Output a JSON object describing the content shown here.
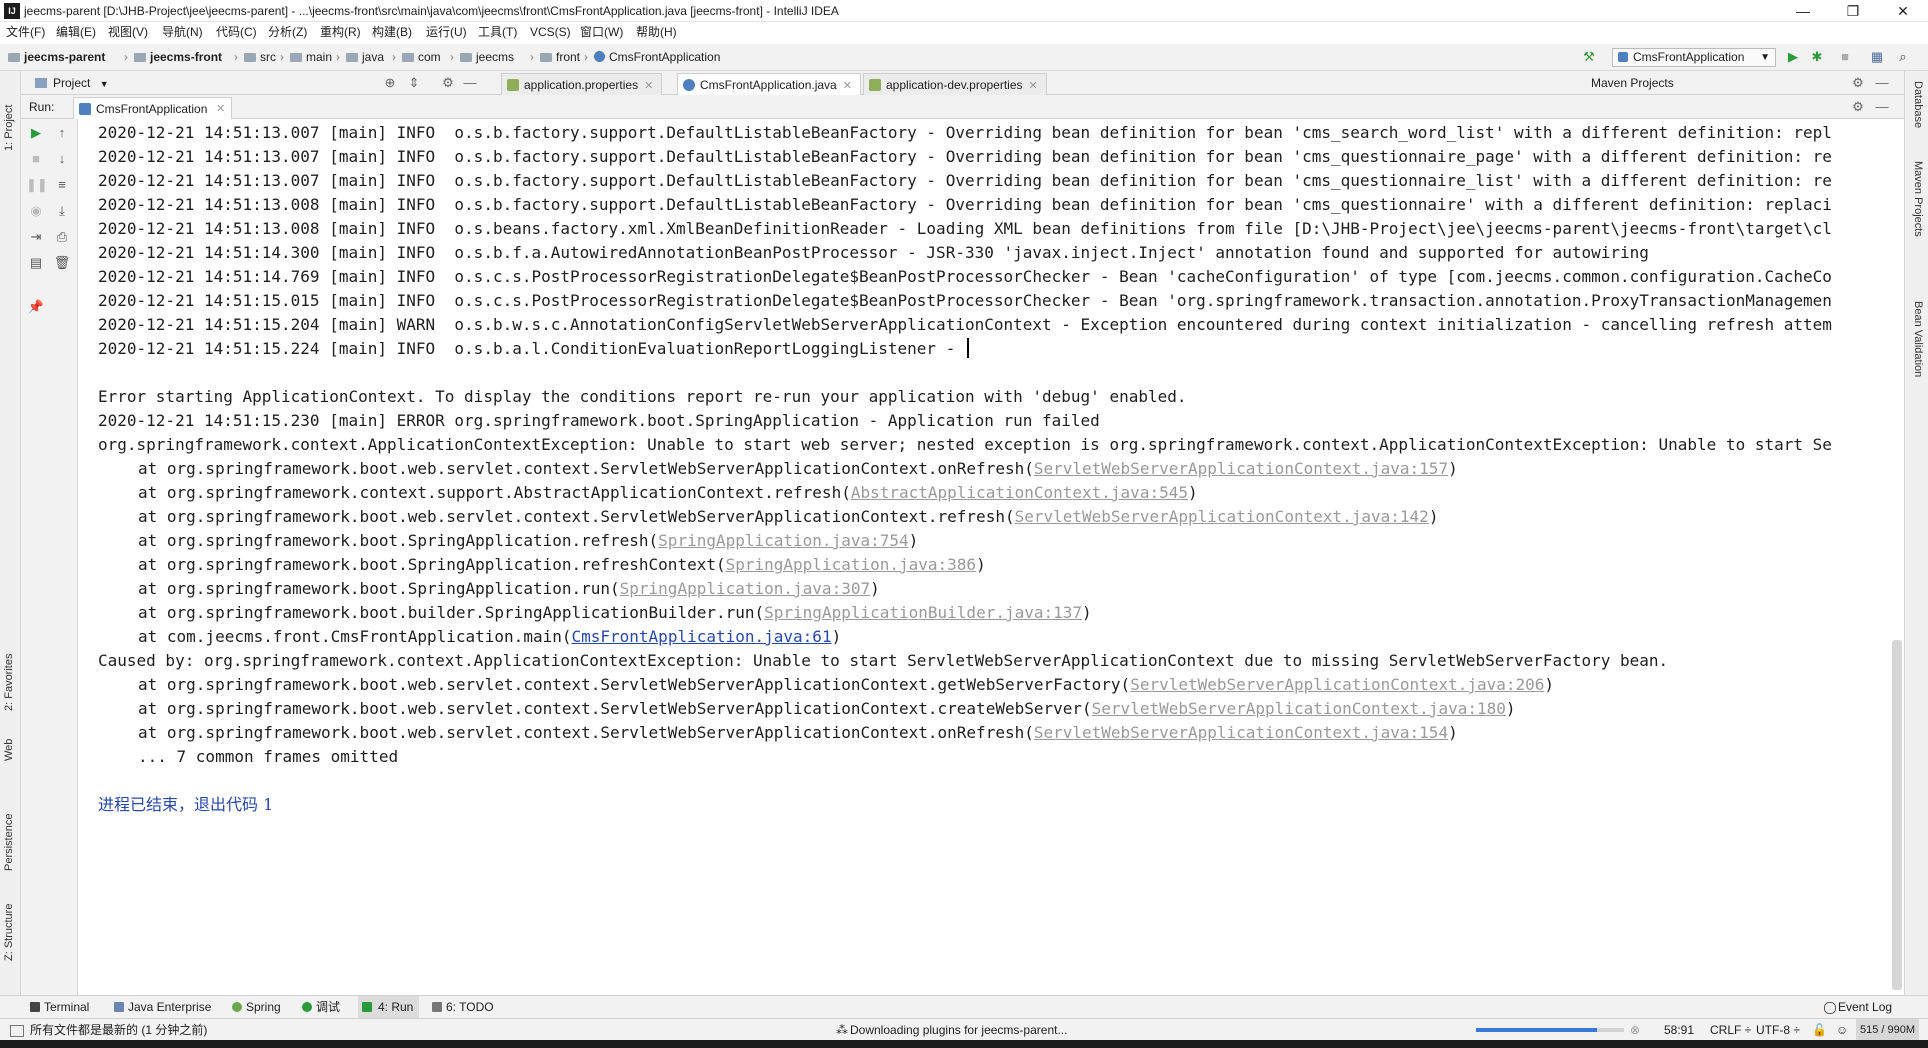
{
  "window": {
    "logo": "IJ",
    "title": "jeecms-parent [D:\\JHB-Project\\jee\\jeecms-parent] - ...\\jeecms-front\\src\\main\\java\\com\\jeecms\\front\\CmsFrontApplication.java [jeecms-front] - IntelliJ IDEA",
    "minimize": "—",
    "maximize": "❐",
    "close": "✕"
  },
  "menu": [
    "文件(F)",
    "编辑(E)",
    "视图(V)",
    "导航(N)",
    "代码(C)",
    "分析(Z)",
    "重构(R)",
    "构建(B)",
    "运行(U)",
    "工具(T)",
    "VCS(S)",
    "窗口(W)",
    "帮助(H)"
  ],
  "breadcrumbs": [
    "jeecms-parent",
    "jeecms-front",
    "src",
    "main",
    "java",
    "com",
    "jeecms",
    "front",
    "CmsFrontApplication"
  ],
  "run_config": "CmsFrontApplication",
  "tabs": {
    "project": "Project",
    "editor": [
      {
        "label": "application.properties",
        "active": false
      },
      {
        "label": "CmsFrontApplication.java",
        "active": true
      },
      {
        "label": "application-dev.properties",
        "active": false
      }
    ],
    "maven": "Maven Projects"
  },
  "run": {
    "label": "Run:",
    "tab": "CmsFrontApplication"
  },
  "left_tools": [
    "1: Project",
    "2: Favorites",
    "Web",
    "Persistence",
    "Z: Structure"
  ],
  "right_tools": [
    "Database",
    "Maven Projects",
    "Bean Validation"
  ],
  "console": [
    {
      "text": "2020-12-21 14:51:13.007 [main] INFO  o.s.b.factory.support.DefaultListableBeanFactory - Overriding bean definition for bean 'cms_search_word_list' with a different definition: repl",
      "indent": false
    },
    {
      "text": "2020-12-21 14:51:13.007 [main] INFO  o.s.b.factory.support.DefaultListableBeanFactory - Overriding bean definition for bean 'cms_questionnaire_page' with a different definition: re",
      "indent": false
    },
    {
      "text": "2020-12-21 14:51:13.007 [main] INFO  o.s.b.factory.support.DefaultListableBeanFactory - Overriding bean definition for bean 'cms_questionnaire_list' with a different definition: re",
      "indent": false
    },
    {
      "text": "2020-12-21 14:51:13.008 [main] INFO  o.s.b.factory.support.DefaultListableBeanFactory - Overriding bean definition for bean 'cms_questionnaire' with a different definition: replaci",
      "indent": false
    },
    {
      "text": "2020-12-21 14:51:13.008 [main] INFO  o.s.beans.factory.xml.XmlBeanDefinitionReader - Loading XML bean definitions from file [D:\\JHB-Project\\jee\\jeecms-parent\\jeecms-front\\target\\cl",
      "indent": false
    },
    {
      "text": "2020-12-21 14:51:14.300 [main] INFO  o.s.b.f.a.AutowiredAnnotationBeanPostProcessor - JSR-330 'javax.inject.Inject' annotation found and supported for autowiring",
      "indent": false
    },
    {
      "text": "2020-12-21 14:51:14.769 [main] INFO  o.s.c.s.PostProcessorRegistrationDelegate$BeanPostProcessorChecker - Bean 'cacheConfiguration' of type [com.jeecms.common.configuration.CacheCo",
      "indent": false
    },
    {
      "text": "2020-12-21 14:51:15.015 [main] INFO  o.s.c.s.PostProcessorRegistrationDelegate$BeanPostProcessorChecker - Bean 'org.springframework.transaction.annotation.ProxyTransactionManagemen",
      "indent": false
    },
    {
      "text": "2020-12-21 14:51:15.204 [main] WARN  o.s.b.w.s.c.AnnotationConfigServletWebServerApplicationContext - Exception encountered during context initialization - cancelling refresh attem",
      "indent": false
    },
    {
      "text": "2020-12-21 14:51:15.224 [main] INFO  o.s.b.a.l.ConditionEvaluationReportLoggingListener - ",
      "indent": false,
      "caret": true
    },
    {
      "text": "",
      "indent": false
    },
    {
      "text": "Error starting ApplicationContext. To display the conditions report re-run your application with 'debug' enabled.",
      "indent": false
    },
    {
      "text": "2020-12-21 14:51:15.230 [main] ERROR org.springframework.boot.SpringApplication - Application run failed",
      "indent": false
    },
    {
      "text": "org.springframework.context.ApplicationContextException: Unable to start web server; nested exception is org.springframework.context.ApplicationContextException: Unable to start Se",
      "indent": false
    },
    {
      "text": "at org.springframework.boot.web.servlet.context.ServletWebServerApplicationContext.onRefresh(",
      "link": "ServletWebServerApplicationContext.java:157",
      "tail": ")",
      "indent": true
    },
    {
      "text": "at org.springframework.context.support.AbstractApplicationContext.refresh(",
      "link": "AbstractApplicationContext.java:545",
      "tail": ")",
      "indent": true
    },
    {
      "text": "at org.springframework.boot.web.servlet.context.ServletWebServerApplicationContext.refresh(",
      "link": "ServletWebServerApplicationContext.java:142",
      "tail": ")",
      "indent": true
    },
    {
      "text": "at org.springframework.boot.SpringApplication.refresh(",
      "link": "SpringApplication.java:754",
      "tail": ")",
      "indent": true
    },
    {
      "text": "at org.springframework.boot.SpringApplication.refreshContext(",
      "link": "SpringApplication.java:386",
      "tail": ")",
      "indent": true
    },
    {
      "text": "at org.springframework.boot.SpringApplication.run(",
      "link": "SpringApplication.java:307",
      "tail": ")",
      "indent": true
    },
    {
      "text": "at org.springframework.boot.builder.SpringApplicationBuilder.run(",
      "link": "SpringApplicationBuilder.java:137",
      "tail": ")",
      "indent": true
    },
    {
      "text": "at com.jeecms.front.CmsFrontApplication.main(",
      "link": "CmsFrontApplication.java:61",
      "tail": ")",
      "indent": true,
      "link_blue": true
    },
    {
      "text": "Caused by: org.springframework.context.ApplicationContextException: Unable to start ServletWebServerApplicationContext due to missing ServletWebServerFactory bean.",
      "indent": false
    },
    {
      "text": "at org.springframework.boot.web.servlet.context.ServletWebServerApplicationContext.getWebServerFactory(",
      "link": "ServletWebServerApplicationContext.java:206",
      "tail": ")",
      "indent": true
    },
    {
      "text": "at org.springframework.boot.web.servlet.context.ServletWebServerApplicationContext.createWebServer(",
      "link": "ServletWebServerApplicationContext.java:180",
      "tail": ")",
      "indent": true
    },
    {
      "text": "at org.springframework.boot.web.servlet.context.ServletWebServerApplicationContext.onRefresh(",
      "link": "ServletWebServerApplicationContext.java:154",
      "tail": ")",
      "indent": true
    },
    {
      "text": "... 7 common frames omitted",
      "indent": true
    },
    {
      "text": "",
      "indent": false
    },
    {
      "text": "进程已结束，退出代码 1",
      "indent": false,
      "exit": true
    }
  ],
  "tool_windows": [
    {
      "label": "Terminal",
      "active": false
    },
    {
      "label": "Java Enterprise",
      "active": false
    },
    {
      "label": "Spring",
      "active": false
    },
    {
      "label": "调试",
      "active": false
    },
    {
      "label": "4: Run",
      "active": true
    },
    {
      "label": "6: TODO",
      "active": false
    }
  ],
  "event_log": "Event Log",
  "status": {
    "left": "所有文件都是最新的 (1 分钟之前)",
    "task": "Downloading plugins for jeecms-parent...",
    "progress": 0.82,
    "position": "58:91",
    "line_sep": "CRLF ÷",
    "encoding": "UTF-8 ÷",
    "memory": "515 / 990M"
  }
}
